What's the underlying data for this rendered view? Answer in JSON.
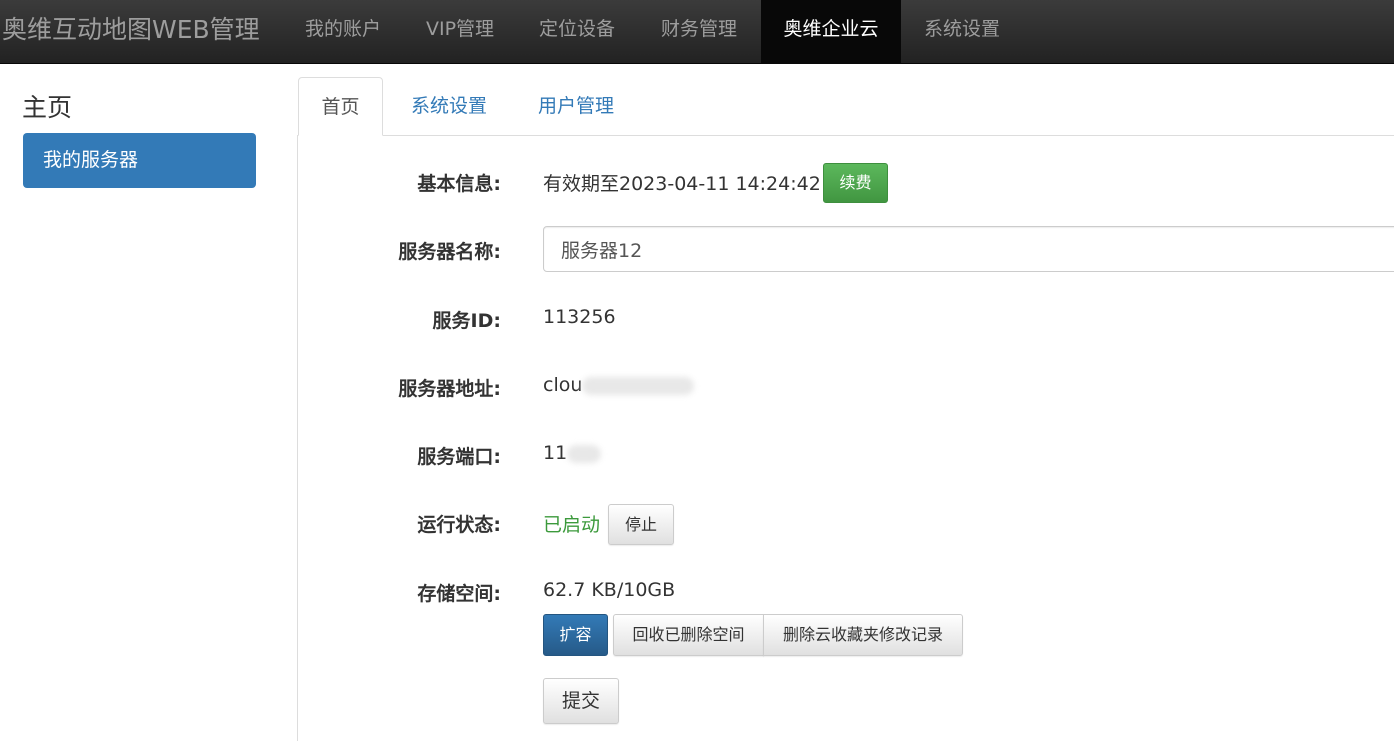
{
  "app": {
    "brand": "奥维互动地图WEB管理"
  },
  "navbar": {
    "items": [
      {
        "label": "我的账户"
      },
      {
        "label": "VIP管理"
      },
      {
        "label": "定位设备"
      },
      {
        "label": "财务管理"
      },
      {
        "label": "奥维企业云",
        "active": true
      },
      {
        "label": "系统设置"
      }
    ]
  },
  "sidebar": {
    "title": "主页",
    "items": [
      {
        "label": "我的服务器",
        "active": true
      }
    ]
  },
  "tabs": [
    {
      "label": "首页",
      "active": true
    },
    {
      "label": "系统设置"
    },
    {
      "label": "用户管理"
    }
  ],
  "form": {
    "basic_info": {
      "label": "基本信息:",
      "value": "有效期至2023-04-11 14:24:42",
      "renew_button": "续费"
    },
    "server_name": {
      "label": "服务器名称:",
      "value": "服务器12"
    },
    "service_id": {
      "label": "服务ID:",
      "value": "113256"
    },
    "server_address": {
      "label": "服务器地址:",
      "value_visible": "clou"
    },
    "service_port": {
      "label": "服务端口:",
      "value_visible": "11"
    },
    "run_status": {
      "label": "运行状态:",
      "value": "已启动",
      "stop_button": "停止"
    },
    "storage": {
      "label": "存储空间:",
      "value": "62.7 KB/10GB",
      "expand_button": "扩容",
      "reclaim_button": "回收已删除空间",
      "delete_history_button": "删除云收藏夹修改记录"
    },
    "submit_button": "提交"
  },
  "colors": {
    "navbar_bg": "#222222",
    "active_nav_bg": "#080808",
    "primary": "#337ab7",
    "success": "#5cb85c",
    "status_green": "#3c9a3c"
  }
}
